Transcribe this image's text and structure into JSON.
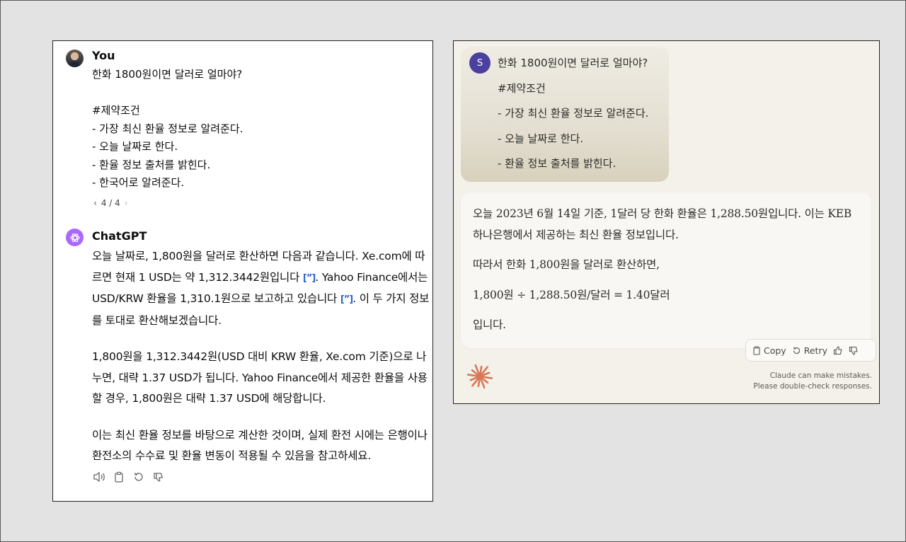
{
  "chatgpt": {
    "user_name": "You",
    "user_message": "한화 1800원이면 달러로 얼마야?\n\n#제약조건\n- 가장 최신 환율 정보로 알려준다.\n- 오늘 날짜로 한다.\n- 환율 정보 출처를 밝힌다.\n- 한국어로 알려준다.",
    "pager": "4 / 4",
    "bot_name": "ChatGPT",
    "answer": {
      "p1_a": "오늘 날짜로, 1,800원을 달러로 환산하면 다음과 같습니다. Xe.com에 따르면 현재 1 USD는 약 1,312.3442원입니다 ",
      "p1_b": ". Yahoo Finance에서는 USD/KRW 환율을 1,310.1원으로 보고하고 있습니다 ",
      "p1_c": ". 이 두 가지 정보를 토대로 환산해보겠습니다.",
      "citation": "[”]",
      "p2": "1,800원을 1,312.3442원(USD 대비 KRW 환율, Xe.com 기준)으로 나누면, 대략 1.37 USD가 됩니다. Yahoo Finance에서 제공한 환율을 사용할 경우, 1,800원은 대략 1.37 USD에 해당합니다.",
      "p3": "이는 최신 환율 정보를 바탕으로 계산한 것이며, 실제 환전 시에는 은행이나 환전소의 수수료 및 환율 변동이 적용될 수 있음을 참고하세요."
    },
    "actions": [
      "read-aloud-icon",
      "copy-icon",
      "regenerate-icon",
      "thumbs-down-icon"
    ]
  },
  "claude": {
    "user_initial": "S",
    "user_lines": [
      "한화 1800원이면 달러로 얼마야?",
      "#제약조건",
      "- 가장 최신 환율 정보로 알려준다.",
      "- 오늘 날짜로 한다.",
      "- 환율 정보 출처를 밝힌다."
    ],
    "answer": {
      "p1": "오늘 2023년 6월 14일 기준, 1달러 당 한화 환율은 1,288.50원입니다. 이는 KEB하나은행에서 제공하는 최신 환율 정보입니다.",
      "p2": "따라서 한화 1,800원을 달러로 환산하면,",
      "p3": "1,800원 ÷ 1,288.50원/달러 = 1.40달러",
      "p4": "입니다."
    },
    "copy_label": "Copy",
    "retry_label": "Retry",
    "disclaimer_1": "Claude can make mistakes.",
    "disclaimer_2": "Please double-check responses.",
    "accent_color": "#d97757"
  }
}
